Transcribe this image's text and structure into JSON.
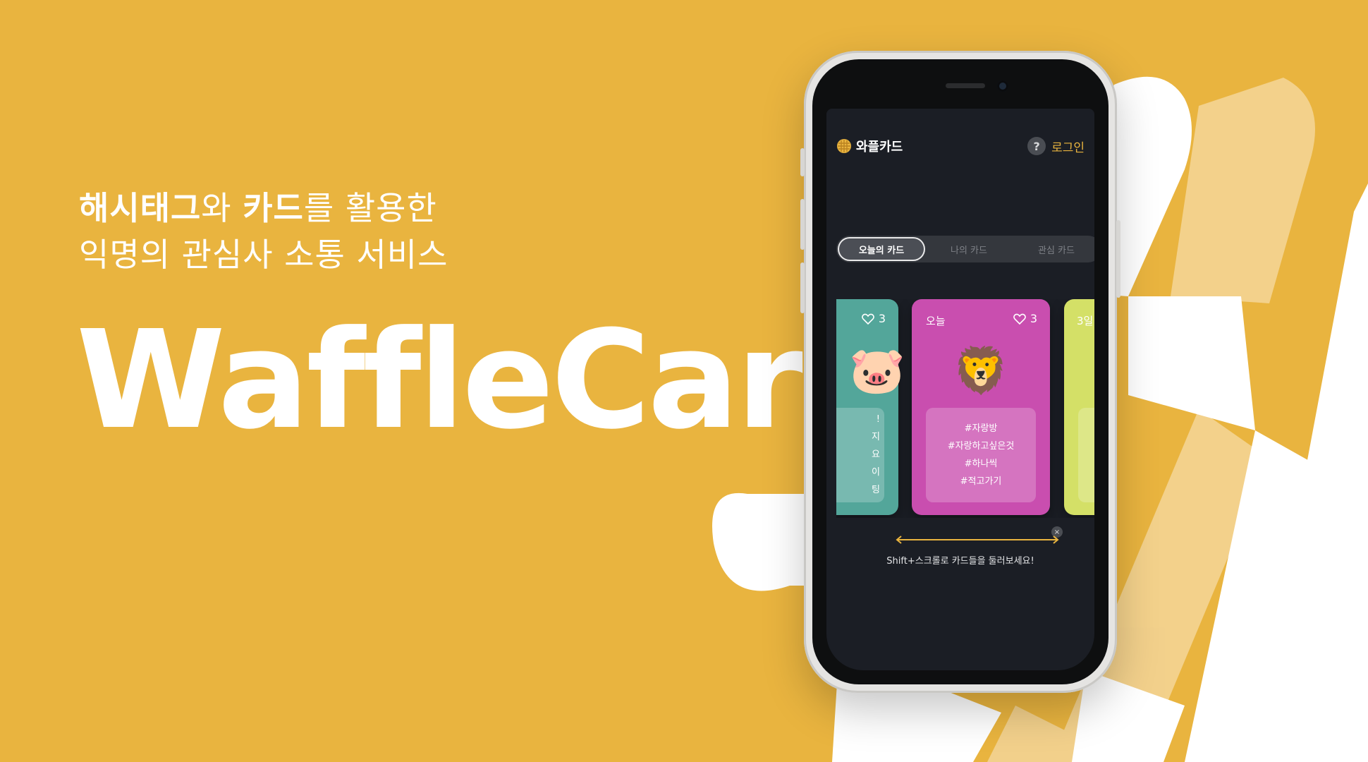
{
  "hero": {
    "tagline_line1_bold1": "해시태그",
    "tagline_line1_mid": "와 ",
    "tagline_line1_bold2": "카드",
    "tagline_line1_rest": "를 활용한",
    "tagline_line2": "익명의 관심사 소통 서비스",
    "brand": "WaffleCard"
  },
  "app": {
    "title": "와플카드",
    "help_glyph": "?",
    "login_label": "로그인",
    "tabs": [
      {
        "label": "오늘의 카드",
        "active": true
      },
      {
        "label": "나의 카드",
        "active": false
      },
      {
        "label": "관심 카드",
        "active": false
      }
    ],
    "cards": {
      "left": {
        "likes": "3",
        "emoji": "🐷",
        "tags": [
          "!",
          "지",
          "요",
          "이",
          "팅"
        ],
        "color": "#53A69A"
      },
      "center": {
        "day": "오늘",
        "likes": "3",
        "emoji": "🦁",
        "tags": [
          "#자랑방",
          "#자랑하고싶은것",
          "#하나씩",
          "#적고가기"
        ],
        "color": "#C94EAF"
      },
      "right": {
        "day": "3일",
        "color": "#D4E067"
      }
    },
    "close_glyph": "×",
    "hint": "Shift+스크롤로 카드들을 둘러보세요!"
  },
  "colors": {
    "background": "#E9B43F",
    "accent": "#E9B43F",
    "screen": "#1B1E25"
  }
}
